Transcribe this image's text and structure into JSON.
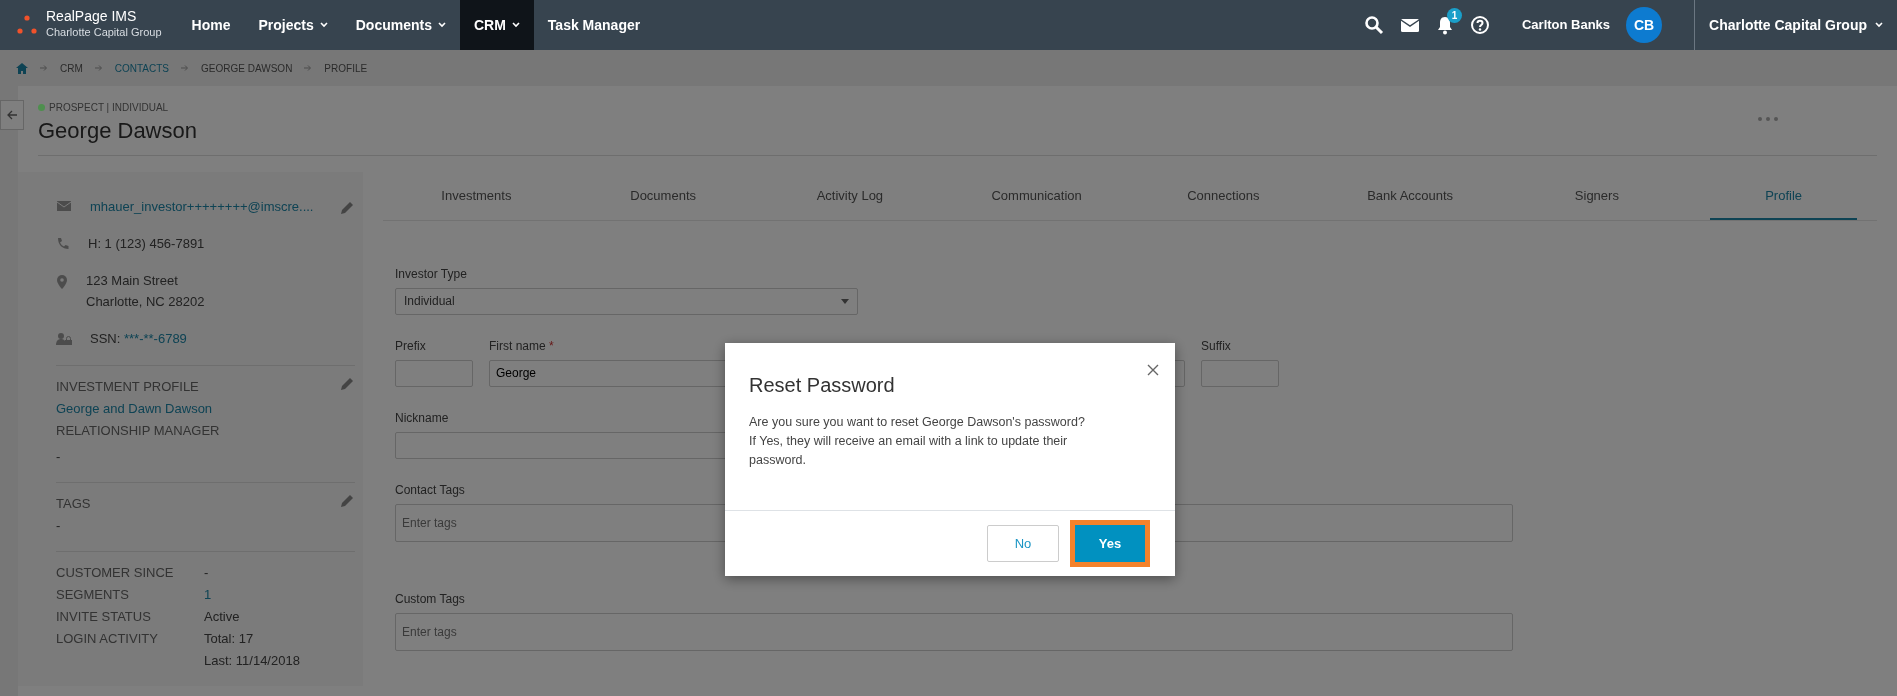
{
  "app": {
    "name": "RealPage IMS",
    "subtitle": "Charlotte Capital Group"
  },
  "nav": [
    {
      "label": "Home",
      "dropdown": false,
      "selected": false
    },
    {
      "label": "Projects",
      "dropdown": true,
      "selected": false
    },
    {
      "label": "Documents",
      "dropdown": true,
      "selected": false
    },
    {
      "label": "CRM",
      "dropdown": true,
      "selected": true
    },
    {
      "label": "Task Manager",
      "dropdown": false,
      "selected": false
    }
  ],
  "notifications": {
    "count": "1"
  },
  "user": {
    "name": "Carlton Banks",
    "initials": "CB"
  },
  "company_switcher": {
    "label": "Charlotte Capital Group"
  },
  "breadcrumb": [
    {
      "label": "CRM",
      "link": false
    },
    {
      "label": "CONTACTS",
      "link": true
    },
    {
      "label": "GEORGE DAWSON",
      "link": false
    },
    {
      "label": "PROFILE",
      "link": false
    }
  ],
  "contact": {
    "status": "PROSPECT | INDIVIDUAL",
    "color": "#4e8f4e",
    "name": "George Dawson"
  },
  "sidebar": {
    "details": [
      {
        "kind": "email",
        "lines": [
          "mhauer_investor++++++++@imscre...."
        ],
        "editable": true
      },
      {
        "kind": "phone",
        "lines": [
          "H: 1 (123) 456-7891"
        ],
        "editable": false
      },
      {
        "kind": "address",
        "lines": [
          "123 Main Street",
          "Charlotte, NC 28202"
        ],
        "editable": false
      },
      {
        "kind": "ssn",
        "label": "SSN:",
        "lines": [
          "***-**-6789"
        ],
        "editable": false
      }
    ],
    "investment_profile": {
      "heading": "INVESTMENT PROFILE",
      "link": "George and Dawn Dawson",
      "subheading": "RELATIONSHIP MANAGER",
      "value": "-"
    },
    "tags": {
      "heading": "TAGS",
      "value": "-"
    },
    "facts": [
      {
        "label": "CUSTOMER SINCE",
        "values": [
          "-"
        ],
        "link": false
      },
      {
        "label": "SEGMENTS",
        "values": [
          "1"
        ],
        "link": true
      },
      {
        "label": "INVITE STATUS",
        "values": [
          "Active"
        ],
        "link": false
      },
      {
        "label": "LOGIN ACTIVITY",
        "values": [
          "Total: 17",
          "Last: 11/14/2018"
        ],
        "link": false
      }
    ]
  },
  "tabs": [
    {
      "label": "Investments",
      "selected": false
    },
    {
      "label": "Documents",
      "selected": false
    },
    {
      "label": "Activity Log",
      "selected": false
    },
    {
      "label": "Communication",
      "selected": false
    },
    {
      "label": "Connections",
      "selected": false
    },
    {
      "label": "Bank Accounts",
      "selected": false
    },
    {
      "label": "Signers",
      "selected": false
    },
    {
      "label": "Profile",
      "selected": true
    }
  ],
  "form": {
    "investor_type": {
      "label": "Investor Type",
      "value": "Individual"
    },
    "name_fields": [
      {
        "kind": "narrow",
        "label": "Prefix"
      },
      {
        "kind": "wide",
        "label": "First name",
        "required_mark": "*",
        "value": "George"
      },
      {
        "kind": "wide"
      },
      {
        "kind": "narrow",
        "label": "Suffix"
      }
    ],
    "nickname": {
      "label": "Nickname"
    },
    "contact_tags": {
      "label": "Contact Tags",
      "placeholder": "Enter tags"
    },
    "custom_tags": {
      "label": "Custom Tags",
      "placeholder": "Enter tags"
    }
  },
  "modal": {
    "title": "Reset Password",
    "message": [
      "Are you sure you want to reset George Dawson's password?",
      "If Yes, they will receive an email with a link to update their password."
    ],
    "buttons": [
      {
        "label": "No",
        "kind": "secondary",
        "highlighted": false
      },
      {
        "label": "Yes",
        "kind": "primary",
        "highlighted": true
      }
    ]
  }
}
